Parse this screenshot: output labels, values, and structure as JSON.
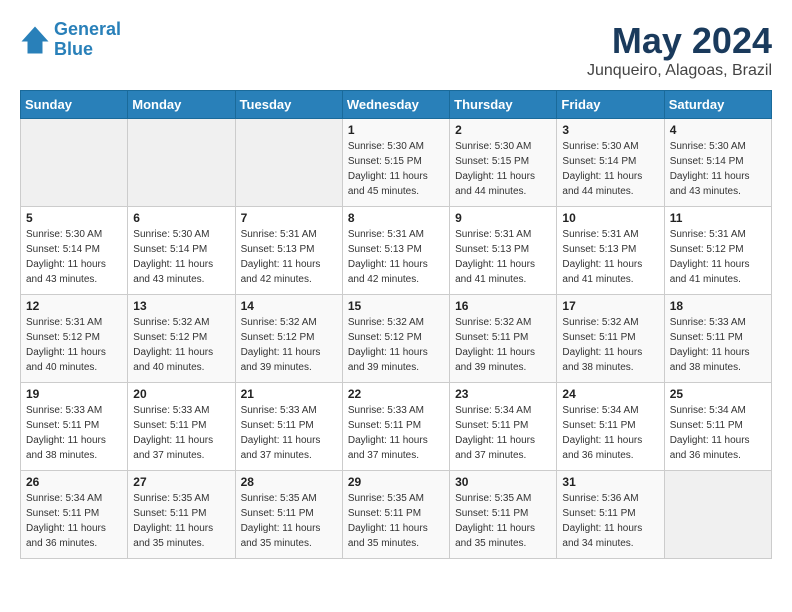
{
  "header": {
    "logo_line1": "General",
    "logo_line2": "Blue",
    "title": "May 2024",
    "subtitle": "Junqueiro, Alagoas, Brazil"
  },
  "weekdays": [
    "Sunday",
    "Monday",
    "Tuesday",
    "Wednesday",
    "Thursday",
    "Friday",
    "Saturday"
  ],
  "weeks": [
    [
      {
        "day": "",
        "sunrise": "",
        "sunset": "",
        "daylight": ""
      },
      {
        "day": "",
        "sunrise": "",
        "sunset": "",
        "daylight": ""
      },
      {
        "day": "",
        "sunrise": "",
        "sunset": "",
        "daylight": ""
      },
      {
        "day": "1",
        "sunrise": "Sunrise: 5:30 AM",
        "sunset": "Sunset: 5:15 PM",
        "daylight": "Daylight: 11 hours and 45 minutes."
      },
      {
        "day": "2",
        "sunrise": "Sunrise: 5:30 AM",
        "sunset": "Sunset: 5:15 PM",
        "daylight": "Daylight: 11 hours and 44 minutes."
      },
      {
        "day": "3",
        "sunrise": "Sunrise: 5:30 AM",
        "sunset": "Sunset: 5:14 PM",
        "daylight": "Daylight: 11 hours and 44 minutes."
      },
      {
        "day": "4",
        "sunrise": "Sunrise: 5:30 AM",
        "sunset": "Sunset: 5:14 PM",
        "daylight": "Daylight: 11 hours and 43 minutes."
      }
    ],
    [
      {
        "day": "5",
        "sunrise": "Sunrise: 5:30 AM",
        "sunset": "Sunset: 5:14 PM",
        "daylight": "Daylight: 11 hours and 43 minutes."
      },
      {
        "day": "6",
        "sunrise": "Sunrise: 5:30 AM",
        "sunset": "Sunset: 5:14 PM",
        "daylight": "Daylight: 11 hours and 43 minutes."
      },
      {
        "day": "7",
        "sunrise": "Sunrise: 5:31 AM",
        "sunset": "Sunset: 5:13 PM",
        "daylight": "Daylight: 11 hours and 42 minutes."
      },
      {
        "day": "8",
        "sunrise": "Sunrise: 5:31 AM",
        "sunset": "Sunset: 5:13 PM",
        "daylight": "Daylight: 11 hours and 42 minutes."
      },
      {
        "day": "9",
        "sunrise": "Sunrise: 5:31 AM",
        "sunset": "Sunset: 5:13 PM",
        "daylight": "Daylight: 11 hours and 41 minutes."
      },
      {
        "day": "10",
        "sunrise": "Sunrise: 5:31 AM",
        "sunset": "Sunset: 5:13 PM",
        "daylight": "Daylight: 11 hours and 41 minutes."
      },
      {
        "day": "11",
        "sunrise": "Sunrise: 5:31 AM",
        "sunset": "Sunset: 5:12 PM",
        "daylight": "Daylight: 11 hours and 41 minutes."
      }
    ],
    [
      {
        "day": "12",
        "sunrise": "Sunrise: 5:31 AM",
        "sunset": "Sunset: 5:12 PM",
        "daylight": "Daylight: 11 hours and 40 minutes."
      },
      {
        "day": "13",
        "sunrise": "Sunrise: 5:32 AM",
        "sunset": "Sunset: 5:12 PM",
        "daylight": "Daylight: 11 hours and 40 minutes."
      },
      {
        "day": "14",
        "sunrise": "Sunrise: 5:32 AM",
        "sunset": "Sunset: 5:12 PM",
        "daylight": "Daylight: 11 hours and 39 minutes."
      },
      {
        "day": "15",
        "sunrise": "Sunrise: 5:32 AM",
        "sunset": "Sunset: 5:12 PM",
        "daylight": "Daylight: 11 hours and 39 minutes."
      },
      {
        "day": "16",
        "sunrise": "Sunrise: 5:32 AM",
        "sunset": "Sunset: 5:11 PM",
        "daylight": "Daylight: 11 hours and 39 minutes."
      },
      {
        "day": "17",
        "sunrise": "Sunrise: 5:32 AM",
        "sunset": "Sunset: 5:11 PM",
        "daylight": "Daylight: 11 hours and 38 minutes."
      },
      {
        "day": "18",
        "sunrise": "Sunrise: 5:33 AM",
        "sunset": "Sunset: 5:11 PM",
        "daylight": "Daylight: 11 hours and 38 minutes."
      }
    ],
    [
      {
        "day": "19",
        "sunrise": "Sunrise: 5:33 AM",
        "sunset": "Sunset: 5:11 PM",
        "daylight": "Daylight: 11 hours and 38 minutes."
      },
      {
        "day": "20",
        "sunrise": "Sunrise: 5:33 AM",
        "sunset": "Sunset: 5:11 PM",
        "daylight": "Daylight: 11 hours and 37 minutes."
      },
      {
        "day": "21",
        "sunrise": "Sunrise: 5:33 AM",
        "sunset": "Sunset: 5:11 PM",
        "daylight": "Daylight: 11 hours and 37 minutes."
      },
      {
        "day": "22",
        "sunrise": "Sunrise: 5:33 AM",
        "sunset": "Sunset: 5:11 PM",
        "daylight": "Daylight: 11 hours and 37 minutes."
      },
      {
        "day": "23",
        "sunrise": "Sunrise: 5:34 AM",
        "sunset": "Sunset: 5:11 PM",
        "daylight": "Daylight: 11 hours and 37 minutes."
      },
      {
        "day": "24",
        "sunrise": "Sunrise: 5:34 AM",
        "sunset": "Sunset: 5:11 PM",
        "daylight": "Daylight: 11 hours and 36 minutes."
      },
      {
        "day": "25",
        "sunrise": "Sunrise: 5:34 AM",
        "sunset": "Sunset: 5:11 PM",
        "daylight": "Daylight: 11 hours and 36 minutes."
      }
    ],
    [
      {
        "day": "26",
        "sunrise": "Sunrise: 5:34 AM",
        "sunset": "Sunset: 5:11 PM",
        "daylight": "Daylight: 11 hours and 36 minutes."
      },
      {
        "day": "27",
        "sunrise": "Sunrise: 5:35 AM",
        "sunset": "Sunset: 5:11 PM",
        "daylight": "Daylight: 11 hours and 35 minutes."
      },
      {
        "day": "28",
        "sunrise": "Sunrise: 5:35 AM",
        "sunset": "Sunset: 5:11 PM",
        "daylight": "Daylight: 11 hours and 35 minutes."
      },
      {
        "day": "29",
        "sunrise": "Sunrise: 5:35 AM",
        "sunset": "Sunset: 5:11 PM",
        "daylight": "Daylight: 11 hours and 35 minutes."
      },
      {
        "day": "30",
        "sunrise": "Sunrise: 5:35 AM",
        "sunset": "Sunset: 5:11 PM",
        "daylight": "Daylight: 11 hours and 35 minutes."
      },
      {
        "day": "31",
        "sunrise": "Sunrise: 5:36 AM",
        "sunset": "Sunset: 5:11 PM",
        "daylight": "Daylight: 11 hours and 34 minutes."
      },
      {
        "day": "",
        "sunrise": "",
        "sunset": "",
        "daylight": ""
      }
    ]
  ]
}
